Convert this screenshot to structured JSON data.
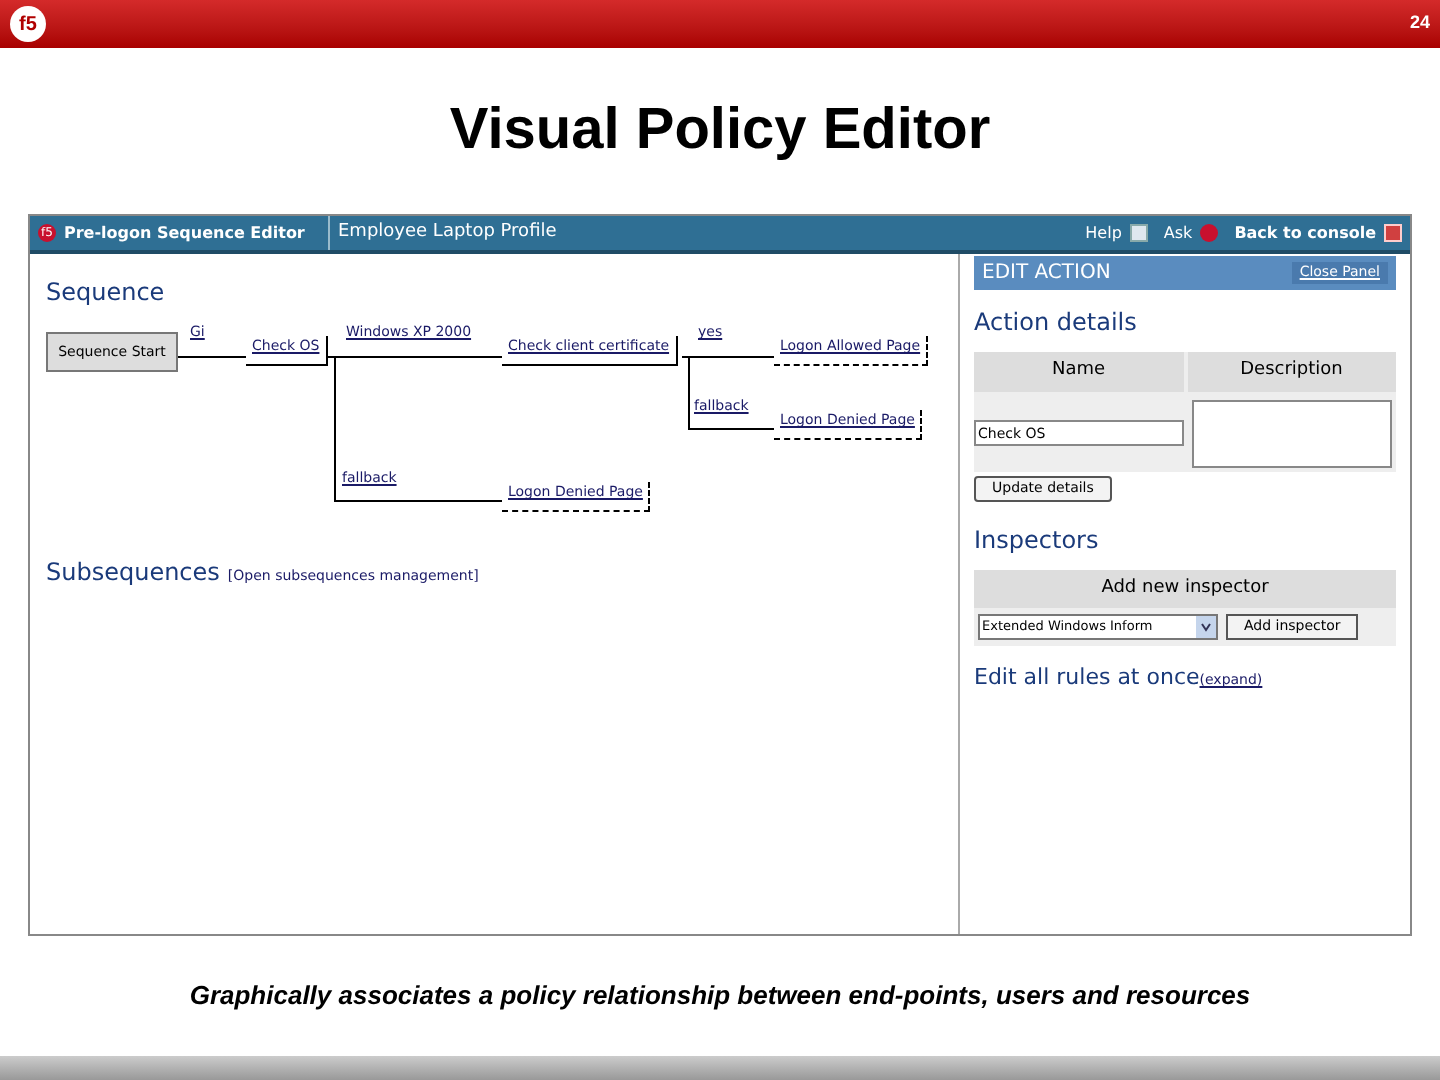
{
  "slide": {
    "logo": "f5",
    "page_number": "24",
    "title": "Visual Policy Editor",
    "caption": "Graphically associates a policy relationship between end-points, users and resources"
  },
  "app": {
    "header": {
      "logo": "f5",
      "title": "Pre-logon Sequence Editor",
      "profile": "Employee Laptop Profile",
      "links": [
        {
          "label": "Help",
          "kind": "help"
        },
        {
          "label": "Ask",
          "kind": "ask"
        },
        {
          "label": "Back to console",
          "kind": "close"
        }
      ]
    },
    "sequence": {
      "heading": "Sequence",
      "start": "Sequence Start",
      "nodes": [
        {
          "kind": "label",
          "text": "Gi"
        },
        {
          "kind": "action",
          "text": "Check OS"
        },
        {
          "kind": "label",
          "text": "Windows XP 2000"
        },
        {
          "kind": "action",
          "text": "Check client certificate"
        },
        {
          "kind": "label",
          "text": "yes"
        },
        {
          "kind": "ending",
          "text": "Logon Allowed Page"
        },
        {
          "kind": "label",
          "text": "fallback"
        },
        {
          "kind": "ending",
          "text": "Logon Denied Page"
        },
        {
          "kind": "label",
          "text": "fallback"
        },
        {
          "kind": "ending",
          "text": "Logon Denied Page"
        }
      ]
    },
    "subsequences": {
      "heading": "Subsequences",
      "link": "[Open subsequences management]"
    },
    "panel": {
      "title": "EDIT ACTION",
      "close": "Close Panel",
      "details_heading": "Action details",
      "columns": [
        "Name",
        "Description"
      ],
      "name_value": "Check OS",
      "update_button": "Update details",
      "inspectors_heading": "Inspectors",
      "add_header": "Add new inspector",
      "select_value": "Extended Windows Inform",
      "add_button": "Add inspector",
      "rules_heading": "Edit all rules at once",
      "expand_link": "(expand)"
    }
  }
}
